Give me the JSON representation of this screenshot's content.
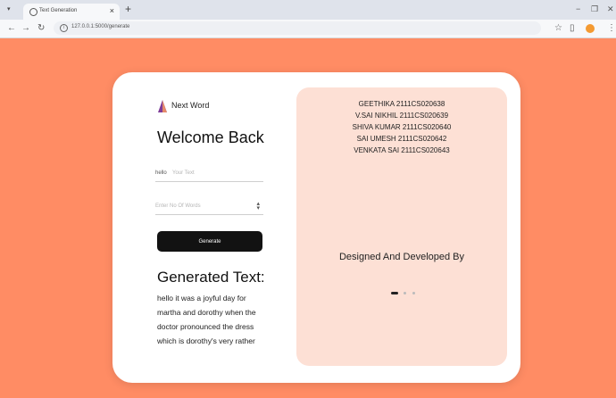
{
  "browser": {
    "tab_title": "Text Generation",
    "url": "127.0.0.1:5000/generate",
    "new_tab": "+",
    "close": "×",
    "minimize": "−",
    "restore": "❐",
    "close_window": "✕"
  },
  "form": {
    "brand": "Next Word",
    "welcome": "Welcome Back",
    "text_value": "hello",
    "text_placeholder": "Your Text",
    "words_placeholder": "Enter No Of Words",
    "generate_label": "Generate",
    "generated_title": "Generated Text:",
    "generated_text": "hello it was a joyful day for martha and dorothy when the doctor pronounced the dress which is dorothy's very rather"
  },
  "panel": {
    "developers": [
      "GEETHIKA 2111CS020638",
      "V.SAI NIKHIL 2111CS020639",
      "SHIVA KUMAR 2111CS020640",
      "SAI UMESH 2111CS020642",
      "VENKATA SAI 2111CS020643"
    ],
    "designed_by": "Designed And Developed By",
    "slide_count": 3,
    "active_slide": 1
  },
  "colors": {
    "background": "#ff8c64",
    "panel": "#fde0d5",
    "button": "#121212"
  }
}
